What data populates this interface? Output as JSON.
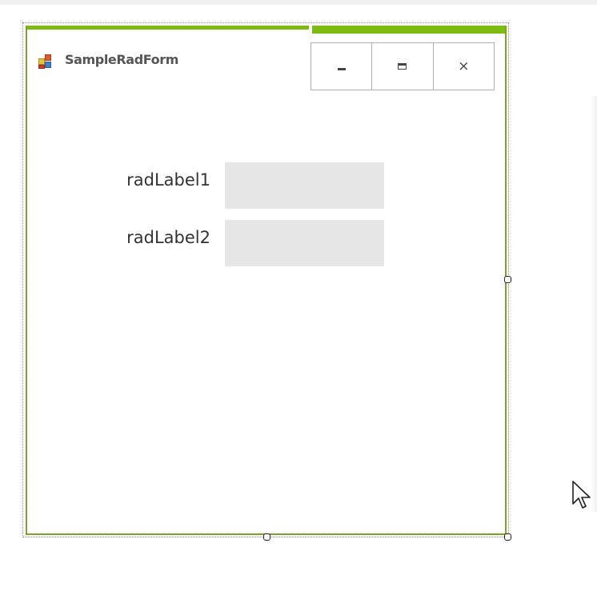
{
  "form": {
    "title": "SampleRadForm",
    "icon": "form-app-icon",
    "accent_color": "#7dbb13",
    "border_color": "#7da22e",
    "caption_buttons": {
      "minimize": "minimize-icon",
      "maximize": "maximize-icon",
      "close_glyph": "×"
    }
  },
  "fields": [
    {
      "label": "radLabel1",
      "value": ""
    },
    {
      "label": "radLabel2",
      "value": ""
    }
  ],
  "designer": {
    "selection_handles": "resize-handle",
    "cursor": "mouse-pointer-icon"
  }
}
